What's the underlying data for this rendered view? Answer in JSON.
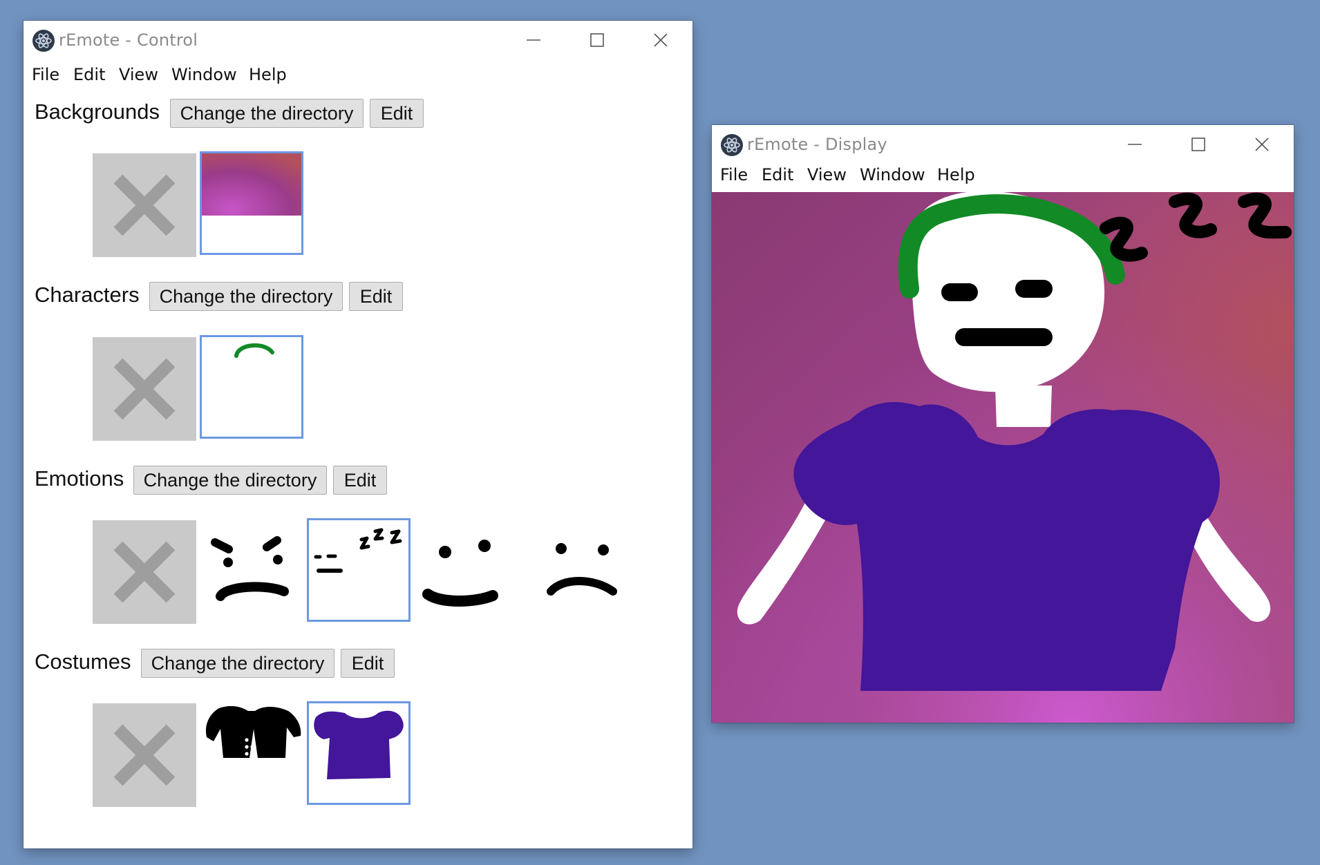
{
  "control": {
    "title": "rEmote - Control",
    "menu": [
      "File",
      "Edit",
      "View",
      "Window",
      "Help"
    ],
    "sections": [
      {
        "label": "Backgrounds",
        "change_dir": "Change the directory",
        "edit": "Edit"
      },
      {
        "label": "Characters",
        "change_dir": "Change the directory",
        "edit": "Edit"
      },
      {
        "label": "Emotions",
        "change_dir": "Change the directory",
        "edit": "Edit"
      },
      {
        "label": "Costumes",
        "change_dir": "Change the directory",
        "edit": "Edit"
      }
    ]
  },
  "display": {
    "title": "rEmote - Display",
    "menu": [
      "File",
      "Edit",
      "View",
      "Window",
      "Help"
    ]
  },
  "colors": {
    "desktop": "#7193c0",
    "selection_border": "#6c98e0",
    "none_tile": "#c9c9c9",
    "hair_green": "#128a26",
    "shirt_purple": "#43169a"
  },
  "icons": {
    "app": "electron-atom-icon",
    "minimize": "minimize-icon",
    "maximize": "maximize-icon",
    "close": "close-icon",
    "none": "x-icon"
  }
}
